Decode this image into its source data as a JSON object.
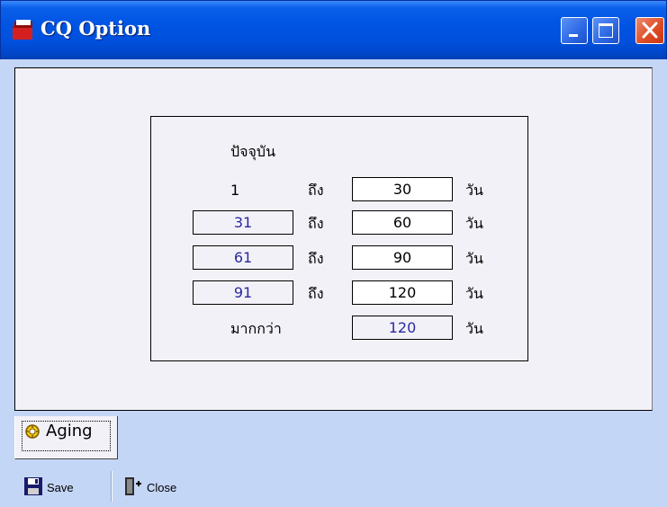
{
  "window": {
    "title": "CQ Option"
  },
  "aging": {
    "header_label": "ปัจจุบัน",
    "to_label": "ถึง",
    "days_label": "วัน",
    "more_than_label": "มากกว่า",
    "rows": [
      {
        "from": "1",
        "to": "30"
      },
      {
        "from": "31",
        "to": "60"
      },
      {
        "from": "61",
        "to": "90"
      },
      {
        "from": "91",
        "to": "120"
      }
    ],
    "more_than_value": "120"
  },
  "tabs": [
    {
      "label": "Aging"
    }
  ],
  "toolbar": {
    "save_label": "Save",
    "close_label": "Close"
  },
  "icons": {
    "app": "folder-red-icon",
    "tab": "clock-gear-icon",
    "save": "floppy-disk-icon",
    "close": "exit-door-icon"
  },
  "colors": {
    "titlebar": "#0054e3",
    "close_button": "#dd4a22",
    "panel_bg": "#f3f1f8",
    "window_bg": "#c4d6f6",
    "blue_value": "#2a2aa0"
  }
}
